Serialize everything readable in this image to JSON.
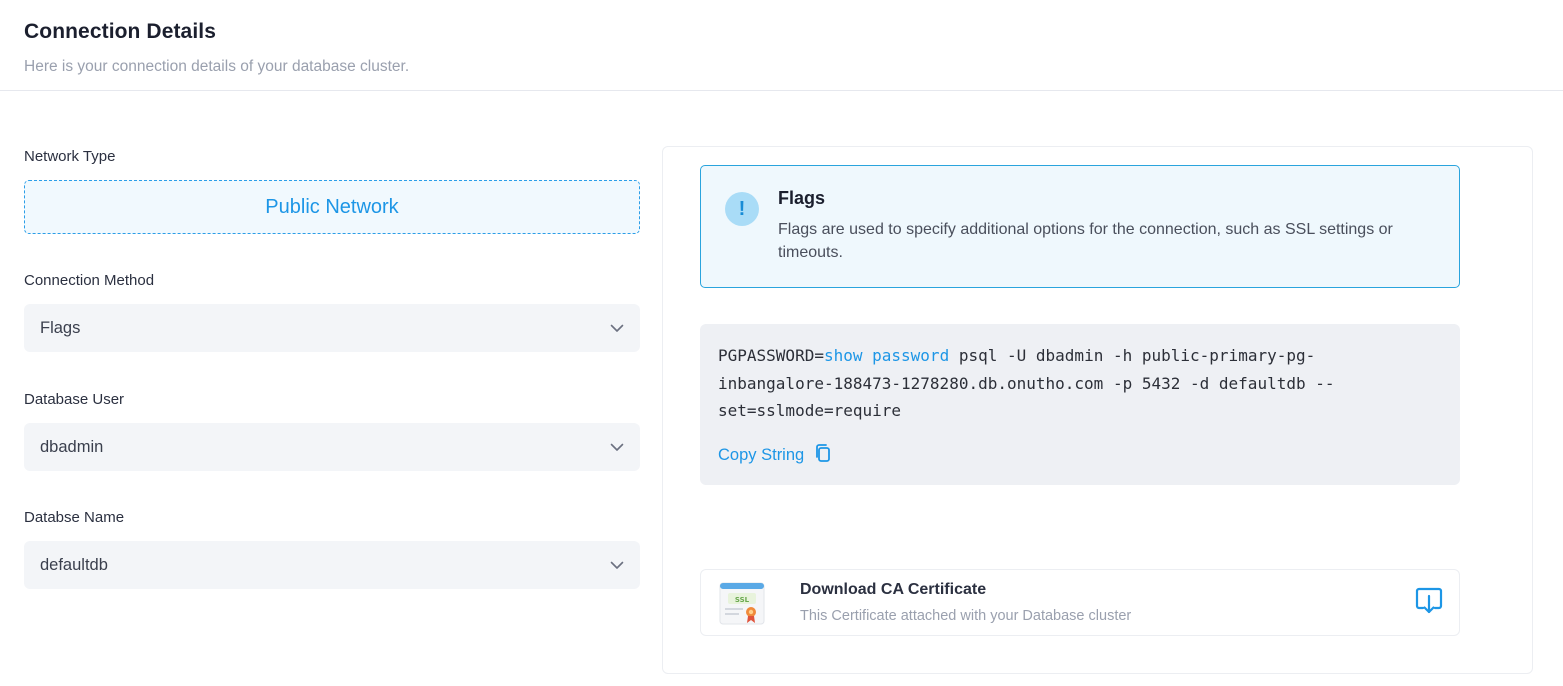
{
  "header": {
    "title": "Connection Details",
    "subtitle": "Here is your connection details of your database cluster."
  },
  "left": {
    "network_type": {
      "label": "Network Type",
      "value": "Public Network"
    },
    "connection_method": {
      "label": "Connection Method",
      "value": "Flags",
      "icon": "chevron-down-icon"
    },
    "database_user": {
      "label": "Database User",
      "value": "dbadmin",
      "icon": "chevron-down-icon"
    },
    "database_name": {
      "label": "Databse Name",
      "value": "defaultdb",
      "icon": "chevron-down-icon"
    }
  },
  "info": {
    "icon": "exclamation-icon",
    "title": "Flags",
    "text": "Flags are used to specify additional options for the connection, such as SSL settings or timeouts."
  },
  "connection_string": {
    "prefix": "PGPASSWORD=",
    "link": "show password",
    "suffix": " psql -U dbadmin -h public-primary-pg-inbangalore-188473-1278280.db.onutho.com -p 5432 -d defaultdb --set=sslmode=require",
    "copy_label": "Copy String",
    "copy_icon": "copy-icon"
  },
  "certificate": {
    "title": "Download CA Certificate",
    "subtitle": "This Certificate attached with your Database cluster",
    "image_label": "SSL",
    "icon": "ssl-certificate-icon",
    "download_icon": "download-icon"
  },
  "colors": {
    "accent": "#1d96e6",
    "info_bg": "#eff8fd",
    "code_bg": "#eef0f4",
    "select_bg": "#f3f5f8"
  }
}
